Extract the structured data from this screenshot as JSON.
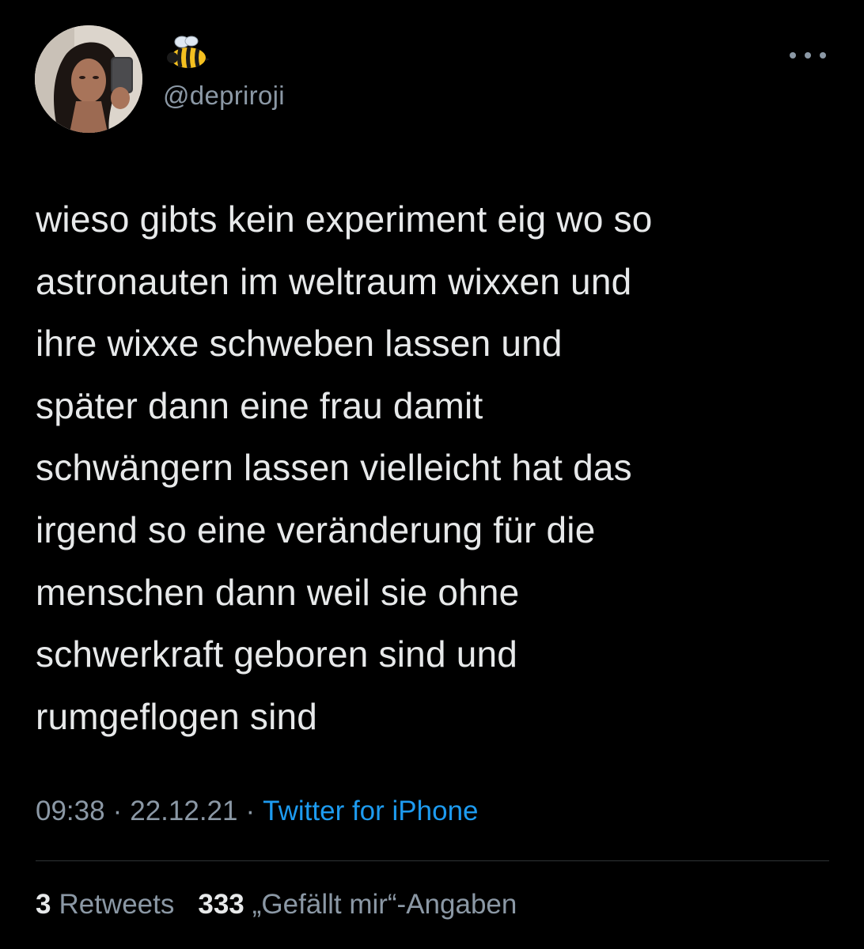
{
  "tweet": {
    "display_name_emoji": "bee-emoji",
    "handle": "@depriroji",
    "text": "wieso gibts kein experiment eig wo so\nastronauten im weltraum wixxen und\nihre wixxe schweben lassen und\nspäter dann eine frau damit\nschwängern lassen vielleicht hat das\nirgend so eine veränderung für die\nmenschen dann weil sie ohne\nschwerkraft geboren sind und\nrumgeflogen sind",
    "time": "09:38",
    "date": "22.12.21",
    "separator": "·",
    "source": "Twitter for iPhone"
  },
  "stats": {
    "retweets_count": "3",
    "retweets_label": "Retweets",
    "likes_count": "333",
    "likes_label": "„Gefällt mir“-Angaben"
  },
  "icons": {
    "more": "more-horizontal-icon",
    "avatar": "profile-avatar"
  },
  "colors": {
    "background": "#000000",
    "text": "#e7e9ea",
    "secondary": "#8b98a5",
    "link": "#1d9bf0",
    "divider": "#2f3336"
  }
}
